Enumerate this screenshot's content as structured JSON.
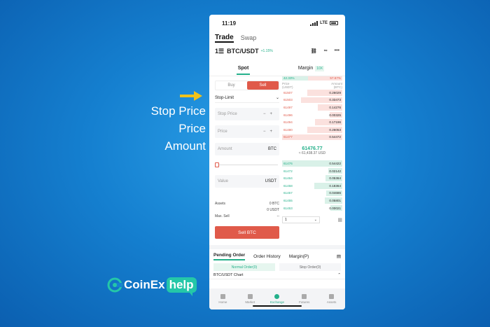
{
  "annotations": {
    "label1": "Stop Price",
    "label2": "Price",
    "label3": "Amount"
  },
  "brand": {
    "name": "CoinEx",
    "help": "help"
  },
  "status": {
    "time": "11:19",
    "network": "LTE"
  },
  "top_tabs": {
    "trade": "Trade",
    "swap": "Swap"
  },
  "pair": {
    "menu_icon": "1☰",
    "name": "BTC/USDT",
    "change": "+1.15%"
  },
  "modes": {
    "spot": "Spot",
    "margin": "Margin",
    "leverage": "10X"
  },
  "form": {
    "buy": "Buy",
    "sell": "Sell",
    "order_type": "Stop-Limit",
    "stop_price_placeholder": "Stop Price",
    "price_placeholder": "Price",
    "amount_placeholder": "Amount",
    "amount_unit": "BTC",
    "value_placeholder": "Value",
    "value_unit": "USDT",
    "assets_label": "Assets",
    "assets_btc": "0 BTC",
    "assets_usdt": "0 USDT",
    "max_sell_label": "Max. Sell",
    "max_sell_value": "--",
    "submit": "Sell BTC"
  },
  "book": {
    "buy_pct": "42.33%",
    "sell_pct": "57.67%",
    "col_price": "Price\n(USDT)",
    "col_amount": "Amount\n(BTC)",
    "asks": [
      [
        "61507",
        "0.26029"
      ],
      [
        "61503",
        "0.33473"
      ],
      [
        "61497",
        "0.14276"
      ],
      [
        "61496",
        "0.00325"
      ],
      [
        "61494",
        "0.17196"
      ],
      [
        "61480",
        "0.26053"
      ],
      [
        "61477",
        "0.54472"
      ]
    ],
    "bids": [
      [
        "61476",
        "0.54422"
      ],
      [
        "61472",
        "0.02142"
      ],
      [
        "61464",
        "0.05364"
      ],
      [
        "61458",
        "0.18364"
      ],
      [
        "61457",
        "0.04686"
      ],
      [
        "61455",
        "0.05801"
      ],
      [
        "61453",
        "0.00021"
      ]
    ],
    "last_price": "61476.77",
    "last_usd": "≈ 61,438.37 USD",
    "depth": "1"
  },
  "orders": {
    "pending": "Pending Order",
    "history": "Order History",
    "margin": "Margin(P)",
    "normal": "Normal Order(0)",
    "stop": "Stop Order(0)",
    "chart": "BTC/USDT Chart"
  },
  "nav": [
    "Home",
    "Market",
    "Exchange",
    "Futures",
    "Assets"
  ]
}
